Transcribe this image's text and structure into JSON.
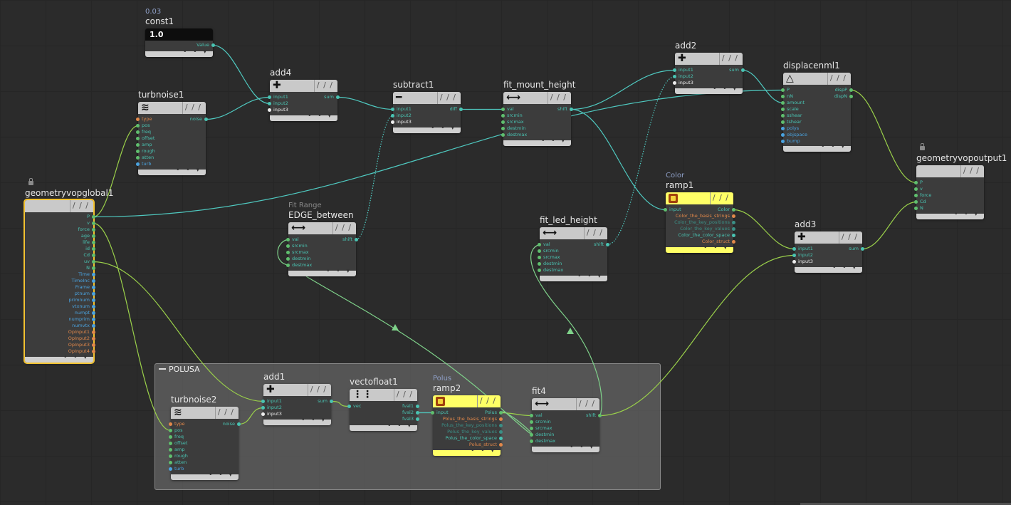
{
  "network_box": {
    "label": "POLUSA"
  },
  "colors": {
    "wire": "#4fc9c0",
    "wire_green": "#9ad04a",
    "selected": "#f2c230",
    "ramp": "#ffff66",
    "port_cyan": "#49c3b2",
    "port_orange": "#e2884a",
    "port_blue": "#4aa3e0"
  },
  "nodes": {
    "const1": {
      "title": "const1",
      "value": "0.03",
      "display": "1.0",
      "ports_out": [
        "Value"
      ]
    },
    "add4": {
      "title": "add4",
      "ports_in": [
        "input1",
        "input2",
        "input3"
      ],
      "ports_out": [
        "sum"
      ]
    },
    "subtract1": {
      "title": "subtract1",
      "ports_in": [
        "input1",
        "input2",
        "input3"
      ],
      "ports_out": [
        "diff"
      ]
    },
    "fit_mount_height": {
      "title": "fit_mount_height",
      "ports_in": [
        "val",
        "srcmin",
        "srcmax",
        "destmin",
        "destmax"
      ],
      "ports_out": [
        "shift"
      ]
    },
    "add2": {
      "title": "add2",
      "ports_in": [
        "input1",
        "input2",
        "input3"
      ],
      "ports_out": [
        "sum"
      ]
    },
    "displacenml1": {
      "title": "displacenml1",
      "ports_in": [
        "P",
        "nN",
        "amount",
        "scale",
        "sshear",
        "tshear",
        "polys",
        "objspace",
        "bump"
      ],
      "ports_out": [
        "dispP",
        "dispN"
      ]
    },
    "turbnoise1": {
      "title": "turbnoise1",
      "ports_in": [
        "type",
        "pos",
        "freq",
        "offset",
        "amp",
        "rough",
        "atten",
        "turb"
      ],
      "ports_out": [
        "noise"
      ]
    },
    "geometryvopglobal1": {
      "title": "geometryvopglobal1",
      "ports_out": [
        "P",
        "v",
        "force",
        "age",
        "life",
        "id",
        "Cd",
        "uv",
        "N",
        "Time",
        "TimeInc",
        "Frame",
        "ptnum",
        "primnum",
        "vtxnum",
        "numpt",
        "numprim",
        "numvtx",
        "OpInput1",
        "OpInput2",
        "OpInput3",
        "OpInput4"
      ]
    },
    "EDGE_between": {
      "title": "EDGE_between",
      "subtitle": "Fit Range",
      "ports_in": [
        "val",
        "srcmin",
        "srcmax",
        "destmin",
        "destmax"
      ],
      "ports_out": [
        "shift"
      ]
    },
    "fit_led_height": {
      "title": "fit_led_height",
      "ports_in": [
        "val",
        "srcmin",
        "srcmax",
        "destmin",
        "destmax"
      ],
      "ports_out": [
        "shift"
      ]
    },
    "ramp1": {
      "title": "ramp1",
      "subtitle": "Color",
      "ports_in": [
        "input"
      ],
      "ports_out": [
        "Color",
        "Color_the_basis_strings",
        "Color_the_key_positions",
        "Color_the_key_values",
        "Color_the_color_space",
        "Color_struct"
      ]
    },
    "add3": {
      "title": "add3",
      "ports_in": [
        "input1",
        "input2",
        "input3"
      ],
      "ports_out": [
        "sum"
      ]
    },
    "geometryvopoutput1": {
      "title": "geometryvopoutput1",
      "ports_in": [
        "P",
        "v",
        "force",
        "Cd",
        "N"
      ]
    },
    "turbnoise2": {
      "title": "turbnoise2",
      "ports_in": [
        "type",
        "pos",
        "freq",
        "offset",
        "amp",
        "rough",
        "atten",
        "turb"
      ],
      "ports_out": [
        "noise"
      ]
    },
    "add1": {
      "title": "add1",
      "ports_in": [
        "input1",
        "input2",
        "input3"
      ],
      "ports_out": [
        "sum"
      ]
    },
    "vectofloat1": {
      "title": "vectofloat1",
      "ports_in": [
        "vec"
      ],
      "ports_out": [
        "fval1",
        "fval2",
        "fval3"
      ]
    },
    "ramp2": {
      "title": "ramp2",
      "subtitle": "Polus",
      "ports_in": [
        "input"
      ],
      "ports_out": [
        "Polus",
        "Polus_the_basis_strings",
        "Polus_the_key_positions",
        "Polus_the_key_values",
        "Polus_the_color_space",
        "Polus_struct"
      ]
    },
    "fit4": {
      "title": "fit4",
      "ports_in": [
        "val",
        "srcmin",
        "srcmax",
        "destmin",
        "destmax"
      ],
      "ports_out": [
        "shift"
      ]
    }
  }
}
